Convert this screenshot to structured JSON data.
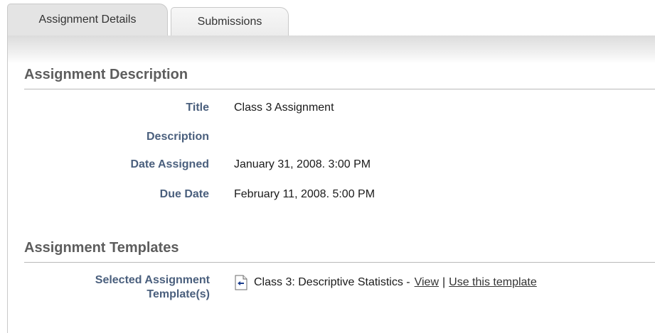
{
  "tabs": [
    {
      "label": "Assignment Details",
      "active": true
    },
    {
      "label": "Submissions",
      "active": false
    }
  ],
  "description_section": {
    "title": "Assignment Description",
    "fields": [
      {
        "label": "Title",
        "value": "Class 3 Assignment"
      },
      {
        "label": "Description",
        "value": ""
      },
      {
        "label": "Date Assigned",
        "value": "January 31, 2008. 3:00 PM"
      },
      {
        "label": "Due Date",
        "value": "February 11, 2008. 5:00 PM"
      }
    ]
  },
  "templates_section": {
    "title": "Assignment Templates",
    "label_line1": "Selected Assignment",
    "label_line2": "Template(s)",
    "template_name": "Class 3: Descriptive Statistics -",
    "view_link": "View",
    "separator": "|",
    "use_link": "Use this template",
    "icon": "document-icon"
  }
}
